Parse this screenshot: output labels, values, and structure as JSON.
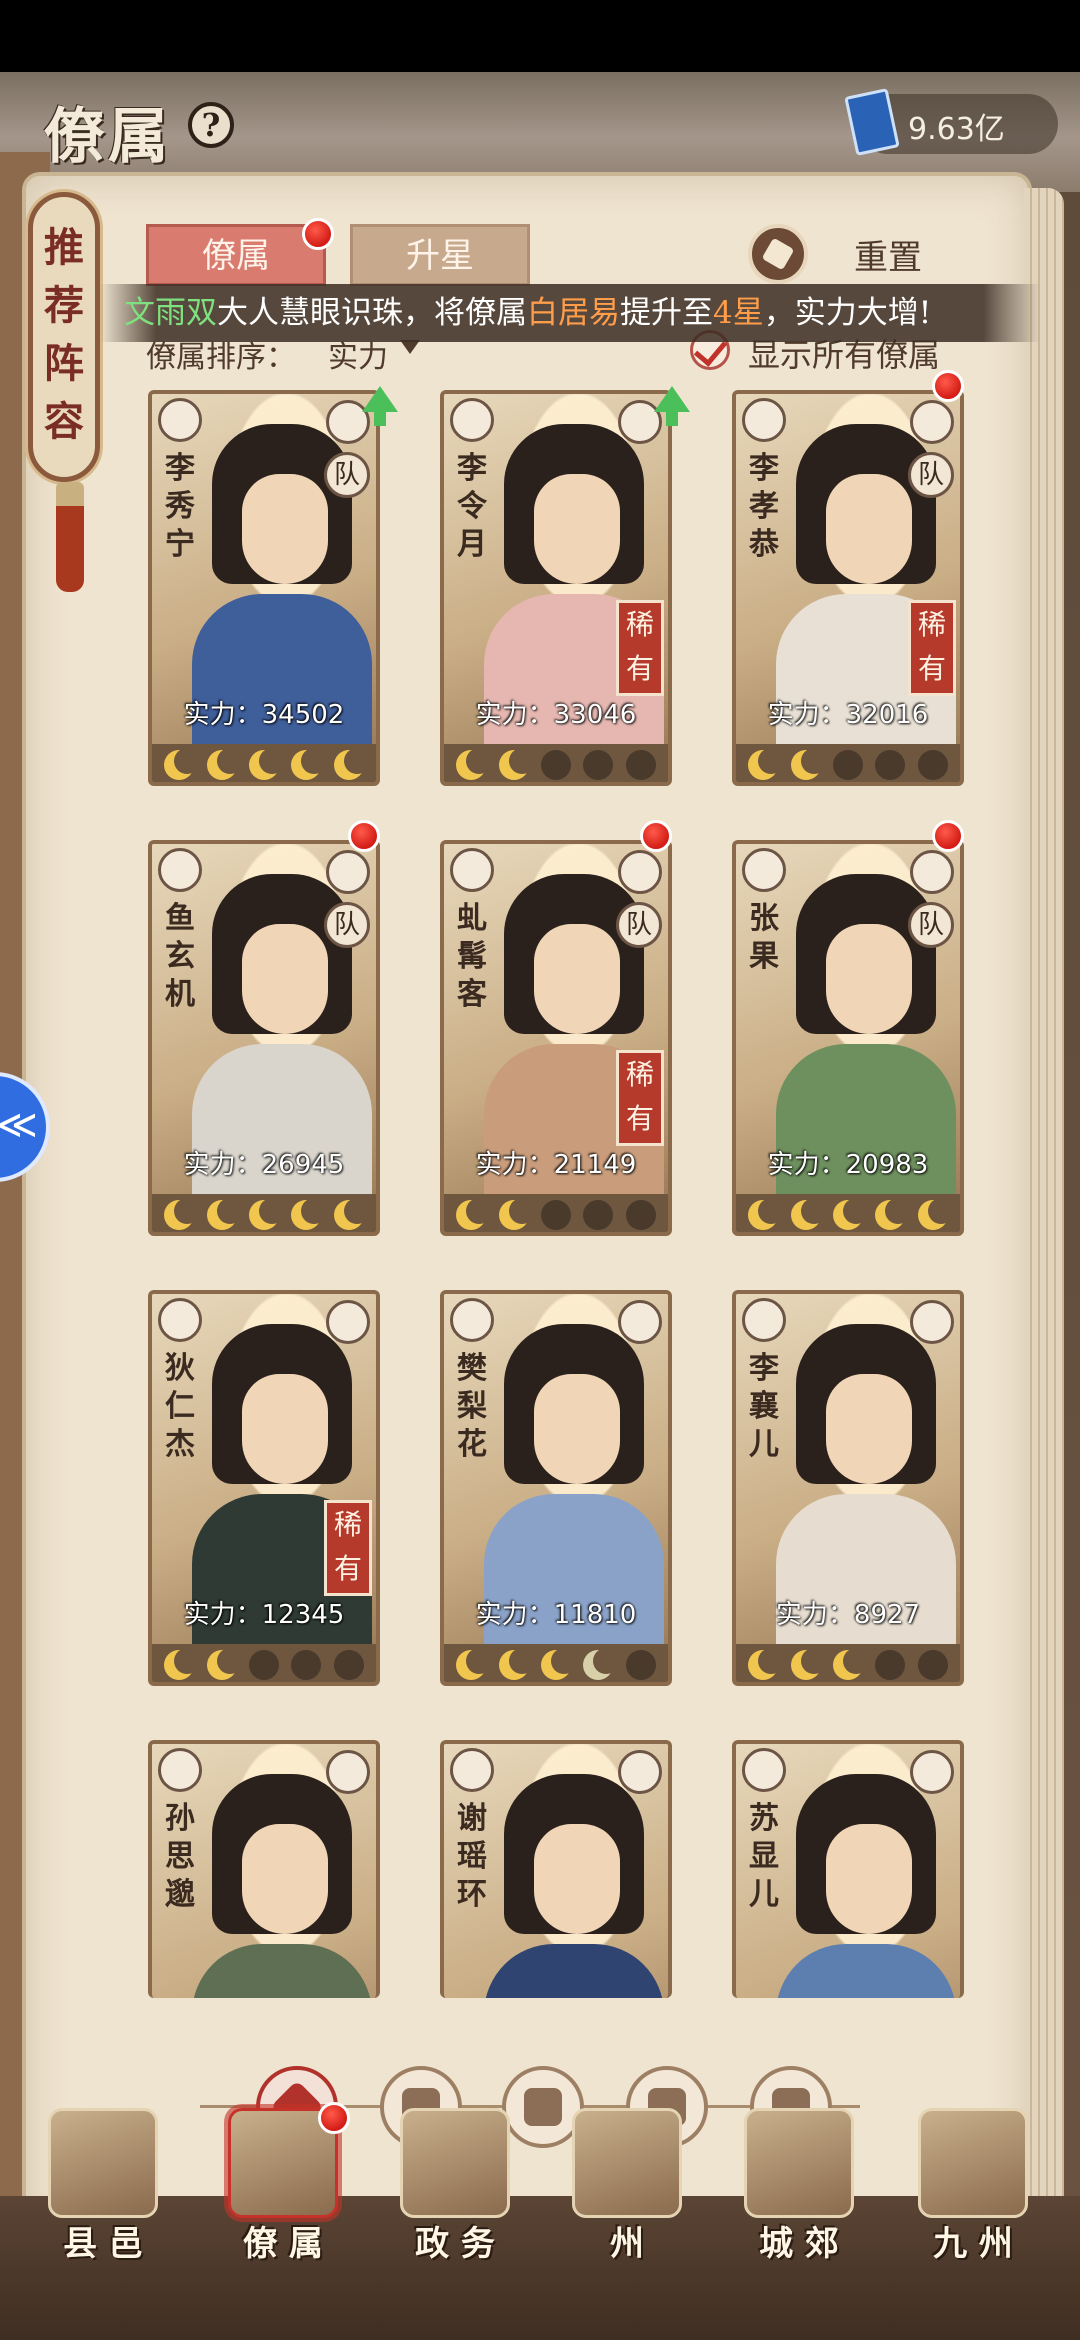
{
  "header": {
    "title": "僚属",
    "help_icon": "help-circle-icon",
    "currency_icon": "book-icon",
    "currency_value": "9.63亿"
  },
  "recommend": {
    "label": "推荐阵容"
  },
  "tabs": [
    {
      "label": "僚属",
      "active": true,
      "has_dot": true
    },
    {
      "label": "升星",
      "active": false,
      "has_dot": false
    }
  ],
  "reset": {
    "label": "重置",
    "icon": "reset-icon"
  },
  "notice": {
    "person": "文雨双",
    "text_a": "大人慧眼识珠，将僚属",
    "retainer": "白居易",
    "text_b": "提升至",
    "stars": "4星",
    "text_c": "，实力大增!"
  },
  "sort": {
    "label": "僚属排序：",
    "value": "实力"
  },
  "show_all": {
    "label": "显示所有僚属",
    "checked": true
  },
  "power_prefix": "实力：",
  "team_badge": "队",
  "rare_badge": "稀有",
  "retainers": [
    {
      "name": "李秀宁",
      "power": "34502",
      "stars": 5,
      "half_star": false,
      "team": true,
      "rare": false,
      "upgrade": true,
      "dot": false
    },
    {
      "name": "李令月",
      "power": "33046",
      "stars": 2,
      "half_star": false,
      "team": false,
      "rare": true,
      "upgrade": true,
      "dot": false
    },
    {
      "name": "李孝恭",
      "power": "32016",
      "stars": 2,
      "half_star": false,
      "team": true,
      "rare": true,
      "upgrade": false,
      "dot": true
    },
    {
      "name": "鱼玄机",
      "power": "26945",
      "stars": 5,
      "half_star": false,
      "team": true,
      "rare": false,
      "upgrade": false,
      "dot": true
    },
    {
      "name": "虬髯客",
      "power": "21149",
      "stars": 2,
      "half_star": false,
      "team": true,
      "rare": true,
      "upgrade": false,
      "dot": true
    },
    {
      "name": "张果",
      "power": "20983",
      "stars": 5,
      "half_star": false,
      "team": true,
      "rare": false,
      "upgrade": false,
      "dot": true
    },
    {
      "name": "狄仁杰",
      "power": "12345",
      "stars": 2,
      "half_star": false,
      "team": false,
      "rare": true,
      "upgrade": false,
      "dot": false
    },
    {
      "name": "樊梨花",
      "power": "11810",
      "stars": 3,
      "half_star": true,
      "team": false,
      "rare": false,
      "upgrade": false,
      "dot": false
    },
    {
      "name": "李襄儿",
      "power": "8927",
      "stars": 3,
      "half_star": false,
      "team": false,
      "rare": false,
      "upgrade": false,
      "dot": false
    },
    {
      "name": "孙思邈",
      "power": "",
      "stars": 0,
      "half_star": false,
      "team": false,
      "rare": false,
      "upgrade": false,
      "dot": false
    },
    {
      "name": "谢瑶环",
      "power": "",
      "stars": 0,
      "half_star": false,
      "team": false,
      "rare": false,
      "upgrade": false,
      "dot": false
    },
    {
      "name": "苏显儿",
      "power": "",
      "stars": 0,
      "half_star": false,
      "team": false,
      "rare": false,
      "upgrade": false,
      "dot": false
    }
  ],
  "filters": [
    {
      "icon": "all-filter-icon",
      "active": true
    },
    {
      "icon": "civil-filter-icon",
      "active": false
    },
    {
      "icon": "cat-filter-icon",
      "active": false
    },
    {
      "icon": "fan-filter-icon",
      "active": false
    },
    {
      "icon": "dragon-filter-icon",
      "active": false
    }
  ],
  "bottom_nav": [
    {
      "label": "县邑",
      "active": false
    },
    {
      "label": "僚属",
      "active": true,
      "has_dot": true
    },
    {
      "label": "政务",
      "active": false
    },
    {
      "label": "州",
      "active": false
    },
    {
      "label": "城郊",
      "active": false
    },
    {
      "label": "九州",
      "active": false
    }
  ]
}
